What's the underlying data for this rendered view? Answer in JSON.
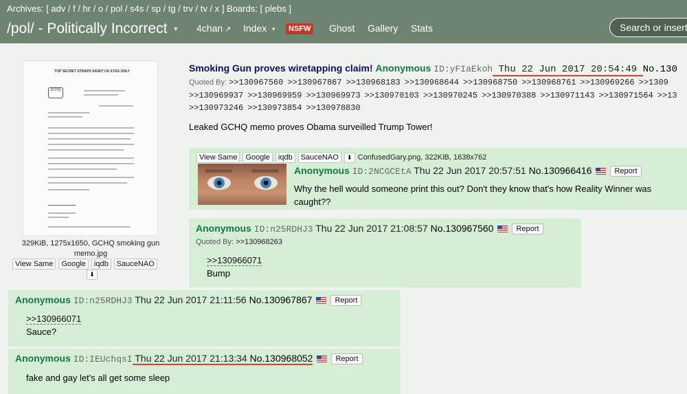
{
  "nav": {
    "archives_label": "Archives: [ adv / f / hr / o / pol / s4s / sp / tg / trv / tv / x ] Boards: [ plebs ]",
    "board_title": "/pol/ - Politically Incorrect",
    "links": {
      "fourchan": "4chan",
      "index": "Index",
      "nsfw": "NSFW",
      "ghost": "Ghost",
      "gallery": "Gallery",
      "stats": "Stats"
    },
    "search_placeholder": "Search or insert"
  },
  "buttons": {
    "view_same": "View Same",
    "google": "Google",
    "iqdb": "iqdb",
    "saucenao": "SauceNAO",
    "report": "Report",
    "download_icon": "download-icon"
  },
  "op": {
    "file_info_line1": "329KiB, 1275x1650, GCHQ smoking gun",
    "file_info_line2": "memo.jpg",
    "thumb_heading": "TOP SECRET STRAPS SIGINT UK EYES ONLY",
    "thumb_crest": "GCHQ",
    "subject": "Smoking Gun proves wiretapping claim!",
    "name": "Anonymous",
    "id": "ID:yFIaEkoh",
    "date": "Thu 22 Jun 2017 20:54:49",
    "number": "No.130",
    "quoted_by_label": "Quoted By:",
    "quoted_by": [
      ">>130967560",
      ">>130967867",
      ">>130968183",
      ">>130968644",
      ">>130968750",
      ">>130968761",
      ">>130969266",
      ">>1309",
      ">>130969937",
      ">>130969959",
      ">>130969973",
      ">>130970103",
      ">>130970245",
      ">>130970388",
      ">>130971143",
      ">>130971564",
      ">>13",
      ">>130973246",
      ">>130973854",
      ">>130978830"
    ],
    "message": "Leaked GCHQ memo proves Obama surveilled Trump Tower!"
  },
  "replies": [
    {
      "file_name": "ConfusedGary.png, 322KiB, 1638x762",
      "name": "Anonymous",
      "id": "ID:2NCGCEtA",
      "date": "Thu 22 Jun 2017 20:57:51",
      "number": "No.130966416",
      "message_line1": "Why the hell would someone print this out? Don't they know that's how Reality Winner was",
      "message_line2": "caught??"
    },
    {
      "name": "Anonymous",
      "id": "ID:n25RDHJ3",
      "date": "Thu 22 Jun 2017 21:08:57",
      "number": "No.130967560",
      "quoted_by_label": "Quoted By:",
      "quoted_by": ">>130968263",
      "quote_link": ">>130966071",
      "message": "Bump"
    },
    {
      "name": "Anonymous",
      "id": "ID:n25RDHJ3",
      "date": "Thu 22 Jun 2017 21:11:56",
      "number": "No.130967867",
      "quote_link": ">>130966071",
      "message": "Sauce?"
    },
    {
      "name": "Anonymous",
      "id": "ID:IEUchqsI",
      "date": "Thu 22 Jun 2017 21:13:34",
      "number": "No.130968052",
      "message": "fake and gay let's all get some sleep"
    }
  ],
  "colors": {
    "nav_bg": "#6e8470",
    "reply_bg": "#d6eed6",
    "name": "#117743",
    "subject": "#0f0c5d",
    "highlight": "#d8432d"
  }
}
